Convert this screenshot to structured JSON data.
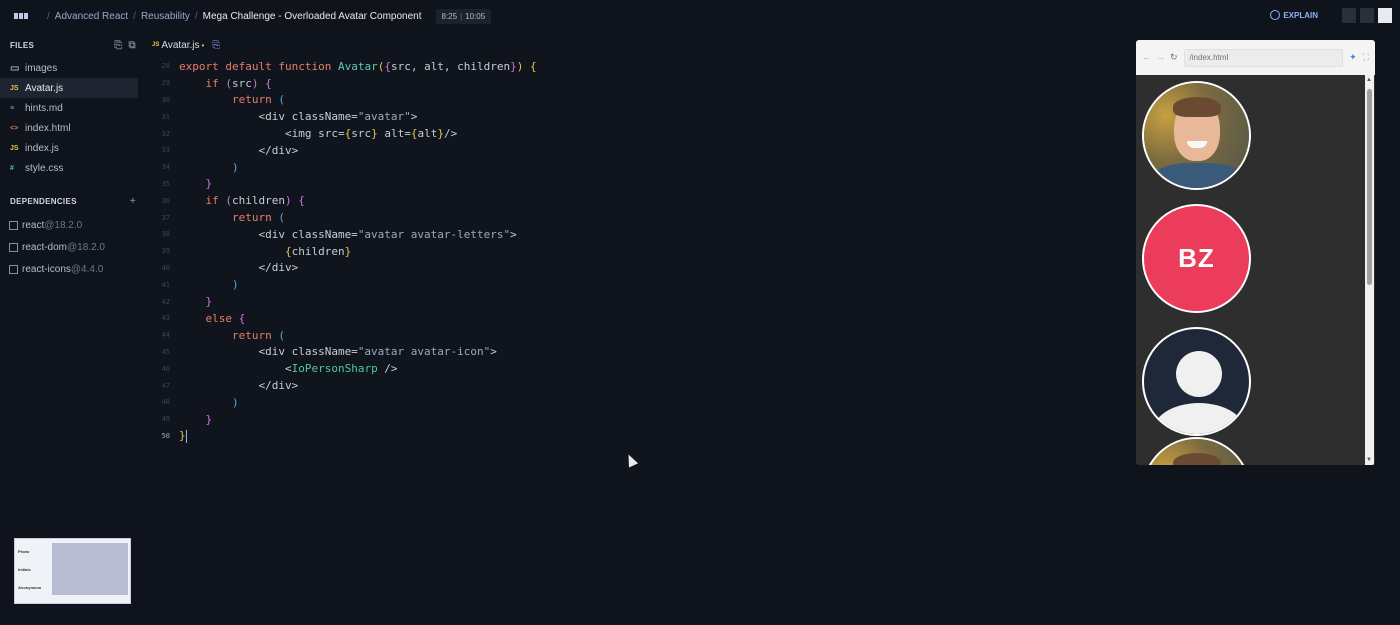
{
  "breadcrumb": {
    "course": "Advanced React",
    "module": "Reusability",
    "lesson": "Mega Challenge - Overloaded Avatar Component"
  },
  "timer": {
    "current": "8:25",
    "total": "10:05"
  },
  "explain_label": "EXPLAIN",
  "sidebar": {
    "files_heading": "FILES",
    "files": [
      {
        "name": "images",
        "type": "folder"
      },
      {
        "name": "Avatar.js",
        "type": "js",
        "active": true
      },
      {
        "name": "hints.md",
        "type": "md"
      },
      {
        "name": "index.html",
        "type": "html"
      },
      {
        "name": "index.js",
        "type": "js"
      },
      {
        "name": "style.css",
        "type": "css"
      }
    ],
    "dependencies_heading": "DEPENDENCIES",
    "dependencies": [
      {
        "name": "react",
        "version": "@18.2.0"
      },
      {
        "name": "react-dom",
        "version": "@18.2.0"
      },
      {
        "name": "react-icons",
        "version": "@4.4.0"
      }
    ],
    "thumbnail_labels": [
      "Photo",
      "Initials",
      "Anonymous"
    ]
  },
  "editor": {
    "tab_label": "Avatar.js",
    "tab_icon": "JS",
    "modified_marker": "•",
    "line_numbers": [
      "28",
      "29",
      "30",
      "31",
      "32",
      "33",
      "34",
      "35",
      "36",
      "37",
      "38",
      "39",
      "40",
      "41",
      "42",
      "43",
      "44",
      "45",
      "46",
      "47",
      "48",
      "49",
      "50"
    ],
    "current_line": "50"
  },
  "preview": {
    "url": "/index.html",
    "avatar_initials": "BZ"
  },
  "colors": {
    "background": "#0f141c",
    "accent": "#8fb0ff",
    "keyword": "#e87c6a",
    "function": "#62c8b0",
    "avatar_letters_bg": "#ec3c5c",
    "avatar_icon_bg": "#1e2838"
  },
  "icons": {
    "logo": "scrimba-logo",
    "new_file": "new-file-icon",
    "new_folder": "new-folder-icon",
    "add_dependency": "plus-icon",
    "refresh": "refresh-icon",
    "pin": "pin-icon",
    "fullscreen": "fullscreen-icon"
  }
}
